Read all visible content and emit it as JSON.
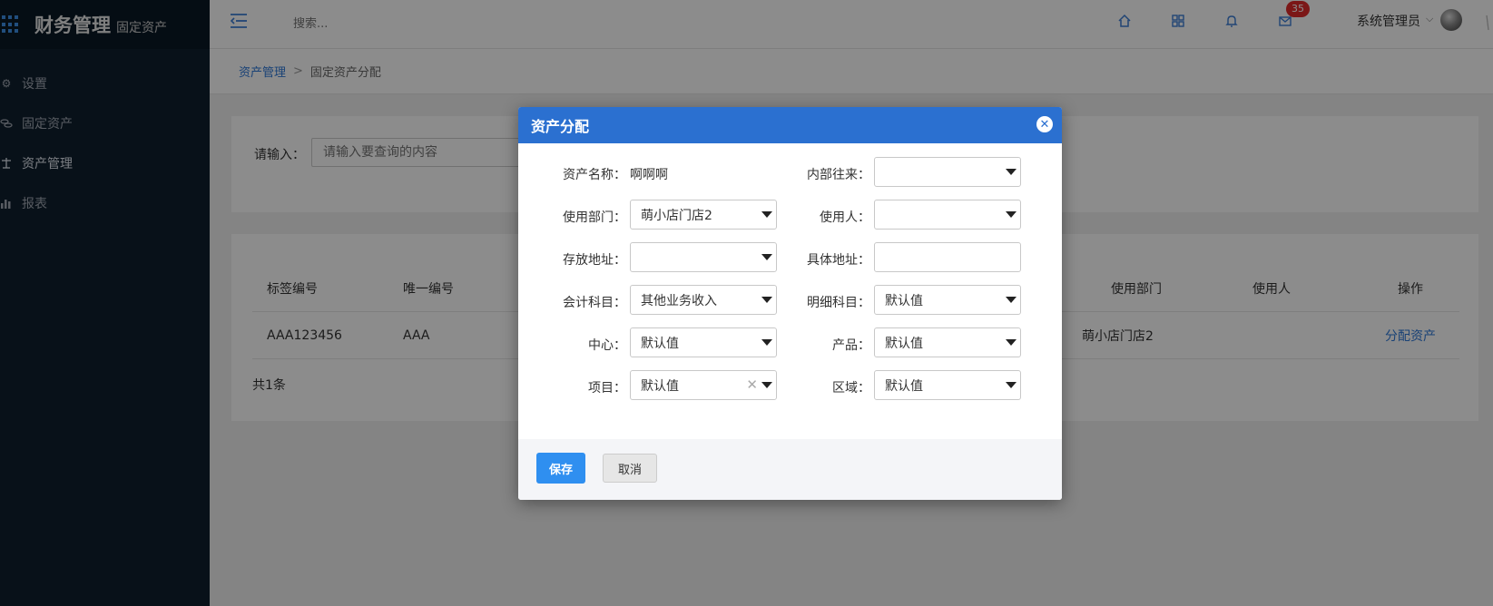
{
  "app": {
    "title": "财务管理",
    "subtitle": "固定资产"
  },
  "sidebar": {
    "items": [
      {
        "label": "设置",
        "icon": "gear-icon",
        "active": false
      },
      {
        "label": "固定资产",
        "icon": "coins-icon",
        "active": false
      },
      {
        "label": "资产管理",
        "icon": "scale-icon",
        "active": true
      },
      {
        "label": "报表",
        "icon": "bar-chart-icon",
        "active": false
      }
    ]
  },
  "header": {
    "search_placeholder": "搜索...",
    "mail_badge": "35",
    "user_name": "系统管理员"
  },
  "breadcrumb": {
    "parent": "资产管理",
    "separator": ">",
    "current": "固定资产分配"
  },
  "search": {
    "label": "请输入：",
    "placeholder": "请输入要查询的内容"
  },
  "table": {
    "headers": [
      "标签编号",
      "唯一编号",
      "使用部门",
      "使用人",
      "操作"
    ],
    "rows": [
      {
        "tag_no": "AAA123456",
        "unique_no": "AAA",
        "department": "萌小店门店2",
        "user": "",
        "action": "分配资产"
      }
    ],
    "footer": "共1条"
  },
  "modal": {
    "title": "资产分配",
    "fields": {
      "asset_name_label": "资产名称：",
      "asset_name_value": "啊啊啊",
      "internal_label": "内部往来：",
      "internal_value": "",
      "dept_label": "使用部门：",
      "dept_value": "萌小店门店2",
      "user_label": "使用人：",
      "user_value": "",
      "storage_label": "存放地址：",
      "storage_value": "",
      "address_label": "具体地址：",
      "address_value": "",
      "account_label": "会计科目：",
      "account_value": "其他业务收入",
      "detail_label": "明细科目：",
      "detail_value": "默认值",
      "center_label": "中心：",
      "center_value": "默认值",
      "product_label": "产品：",
      "product_value": "默认值",
      "project_label": "项目：",
      "project_value": "默认值",
      "region_label": "区域：",
      "region_value": "默认值"
    },
    "save_label": "保存",
    "cancel_label": "取消"
  },
  "colors": {
    "primary": "#2b70d0",
    "sidebar": "#0f1f2e",
    "link": "#2f79d8",
    "badge": "#e02a2a"
  }
}
